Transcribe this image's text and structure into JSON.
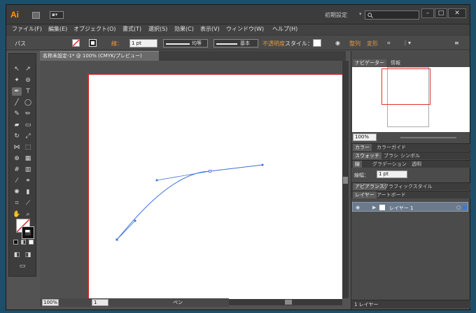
{
  "app": {
    "logo": "Ai",
    "workspace": "初期設定",
    "arrange_label": "▪▾",
    "search_placeholder": ""
  },
  "window_controls": {
    "minimize": "–",
    "maximize": "□",
    "close": "✕"
  },
  "menu": [
    "ファイル(F)",
    "編集(E)",
    "オブジェクト(O)",
    "書式(T)",
    "選択(S)",
    "効果(C)",
    "表示(V)",
    "ウィンドウ(W)",
    "ヘルプ(H)"
  ],
  "control": {
    "context": "パス",
    "stroke_label": "線：",
    "stroke_weight": "1 pt",
    "profile": "均等",
    "brush": "基本",
    "opacity": "不透明度",
    "style_label": "スタイル：",
    "align": "整列",
    "transform": "変形"
  },
  "document": {
    "tab_title": "名称未設定-1* @ 100% (CMYK/プレビュー)",
    "zoom": "100%",
    "page": "1",
    "status_tool": "ペン"
  },
  "navigator": {
    "tab_active": "ナビゲーター",
    "tab_other": "情報",
    "zoom": "100%"
  },
  "color_panel": {
    "tab_active": "カラー",
    "tab_other": "カラーガイド"
  },
  "swatch_panel": {
    "tab_active": "スウォッチ",
    "tabs": [
      "ブラシ",
      "シンボル"
    ]
  },
  "stroke_panel": {
    "tab_active": "線",
    "tabs": [
      "グラデーション",
      "透明"
    ],
    "weight_label": "線幅：",
    "weight": "1 pt"
  },
  "appearance_panel": {
    "tab_active": "アピアランス",
    "tab_other": "グラフィックスタイル"
  },
  "layers_panel": {
    "tab_active": "レイヤー",
    "tab_other": "アートボード",
    "layer_name": "レイヤー 1",
    "footer": "1 レイヤー"
  },
  "colors": {
    "accent": "#ff9a00",
    "artboard_border": "#c62828",
    "path": "#3b6fd9"
  }
}
